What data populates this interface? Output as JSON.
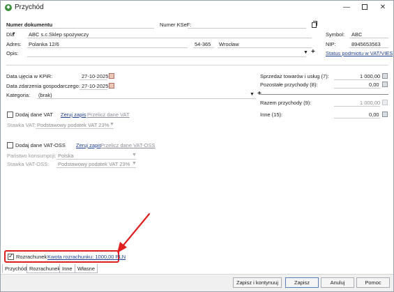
{
  "window": {
    "title": "Przychód",
    "controls": {
      "minimize": "—",
      "close": "✕"
    }
  },
  "header": {
    "doc_number_label": "Numer dokumentu",
    "ksef_label": "Numer KSeF:",
    "dla_label": "Dla",
    "dla_value": "ABC s.c.Sklep spożywczy",
    "adres_label": "Adres:",
    "adres_street": "Polanka 12/6",
    "adres_postal": "54-365",
    "adres_city": "Wrocław",
    "opis_label": "Opis:",
    "symbol_label": "Symbol:",
    "symbol_value": "ABC",
    "nip_label": "NIP:",
    "nip_value": "8945653563",
    "vat_status_link": "Status podmiotu w VAT/VIES"
  },
  "dates": {
    "kpir_label": "Data ujęcia w KPiR:",
    "kpir_value": "27-10-2025",
    "event_label": "Data zdarzenia gospodarczego:",
    "event_value": "27-10-2025",
    "category_label": "Kategoria:",
    "category_value": "(brak)"
  },
  "amounts": {
    "sales_label": "Sprzedaż towarów i usług (7):",
    "sales_value": "1 000,00",
    "other_label": "Pozostałe przychody (8):",
    "other_value": "0,00",
    "total_label": "Razem przychody (9):",
    "total_value": "1 000,00",
    "other15_label": "Inne (15):",
    "other15_value": "0,00"
  },
  "vat": {
    "add_label": "Dodaj dane VAT",
    "reset_link": "Zeruj zapis",
    "recalc_link": "Przelicz dane VAT",
    "rate_label": "Stawka VAT:",
    "rate_value": "Podstawowy podatek VAT 23%"
  },
  "vat_oss": {
    "add_label": "Dodaj dane VAT-OSS",
    "reset_link": "Zeruj zapis",
    "recalc_link": "Przelicz dane VAT-OSS",
    "country_label": "Państwo konsumpcji:",
    "country_value": "Polska",
    "rate_label": "Stawka VAT-OSS:",
    "rate_value": "Podstawowy podatek VAT 23%"
  },
  "settlement": {
    "label": "Rozrachunek",
    "amount_link": "Kwota rozrachunku: 1000,00 PLN",
    "checked": true
  },
  "tabs": [
    "Przychód",
    "Rozrachunek",
    "Inne",
    "Własne"
  ],
  "buttons": {
    "save_continue": "Zapisz i kontynuuj",
    "save": "Zapisz",
    "cancel": "Anuluj",
    "help": "Pomoc"
  },
  "colors": {
    "link": "#1f3f8f",
    "highlight": "#e02020",
    "app_icon": "#3a8f3a"
  }
}
